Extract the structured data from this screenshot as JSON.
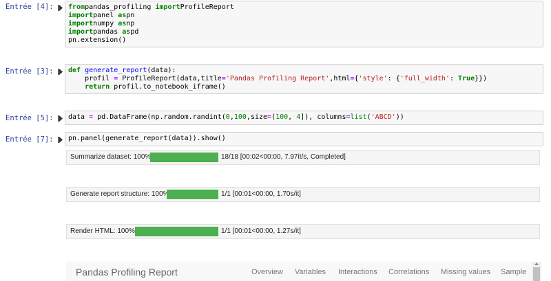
{
  "cells": [
    {
      "prompt": "Entrée [4]:",
      "lines": [
        [
          [
            "kw",
            "from"
          ],
          [
            "",
            "pandas_profiling "
          ],
          [
            "kw",
            "import"
          ],
          [
            "",
            "ProfileReport"
          ]
        ],
        [
          [
            "kw",
            "import"
          ],
          [
            "",
            "panel "
          ],
          [
            "kw",
            "as"
          ],
          [
            "",
            "pn"
          ]
        ],
        [
          [
            "kw",
            "import"
          ],
          [
            "",
            "numpy "
          ],
          [
            "kw",
            "as"
          ],
          [
            "",
            "np"
          ]
        ],
        [
          [
            "kw",
            "import"
          ],
          [
            "",
            "pandas "
          ],
          [
            "kw",
            "as"
          ],
          [
            "",
            "pd"
          ]
        ],
        [
          [
            "",
            "pn.extension()"
          ]
        ]
      ]
    },
    {
      "prompt": "Entrée [3]:",
      "lines": [
        [
          [
            "kw",
            "def"
          ],
          [
            "",
            " "
          ],
          [
            "def",
            "generate_report"
          ],
          [
            "",
            "(data):"
          ]
        ],
        [
          [
            "",
            "    profil "
          ],
          [
            "op",
            "="
          ],
          [
            "",
            " ProfileReport(data,title"
          ],
          [
            "op",
            "="
          ],
          [
            "str",
            "'Pandas Profiling Report'"
          ],
          [
            "",
            ",html"
          ],
          [
            "op",
            "="
          ],
          [
            "",
            "{"
          ],
          [
            "str",
            "'style'"
          ],
          [
            "",
            ": {"
          ],
          [
            "str",
            "'full_width'"
          ],
          [
            "",
            ": "
          ],
          [
            "kw",
            "True"
          ],
          [
            "",
            "}})"
          ]
        ],
        [
          [
            "",
            "    "
          ],
          [
            "kw",
            "return"
          ],
          [
            "",
            ""
          ],
          [
            "",
            " profil.to_notebook_iframe()"
          ]
        ]
      ]
    },
    {
      "prompt": "Entrée [5]:",
      "lines": [
        [
          [
            "",
            "data "
          ],
          [
            "op",
            "="
          ],
          [
            "",
            " pd.DataFrame(np.random.randint("
          ],
          [
            "num",
            "0"
          ],
          [
            "",
            ","
          ],
          [
            "num",
            "100"
          ],
          [
            "",
            ",size"
          ],
          [
            "op",
            "="
          ],
          [
            "",
            "("
          ],
          [
            "num",
            "100"
          ],
          [
            "",
            ", "
          ],
          [
            "num",
            "4"
          ],
          [
            "",
            "]), columns"
          ],
          [
            "op",
            "="
          ],
          [
            "bi",
            "list"
          ],
          [
            "",
            "("
          ],
          [
            "str",
            "'ABCD'"
          ],
          [
            "",
            "))"
          ]
        ]
      ]
    },
    {
      "prompt": "Entrée [7]:",
      "lines": [
        [
          [
            "",
            "pn.panel(generate_report(data)).show()"
          ]
        ]
      ]
    }
  ],
  "progress": [
    {
      "label": "Summarize dataset: 100%",
      "percent": 100,
      "stats": "18/18 [00:02<00:00, 7.97it/s, Completed]"
    },
    {
      "label": "Generate report structure: 100%",
      "percent": 100,
      "stats": "1/1 [00:01<00:00, 1.70s/it]"
    },
    {
      "label": "Render HTML: 100%",
      "percent": 100,
      "stats": "1/1 [00:01<00:00, 1.27s/it]"
    }
  ],
  "report": {
    "title": "Pandas Profiling Report",
    "nav": [
      "Overview",
      "Variables",
      "Interactions",
      "Correlations",
      "Missing values",
      "Sample"
    ]
  },
  "colors": {
    "prompt": "#303f9f",
    "progress_bar": "#4caf50",
    "keyword": "#008000",
    "string": "#ba2121"
  },
  "icons": {
    "run": "step-run-icon"
  }
}
